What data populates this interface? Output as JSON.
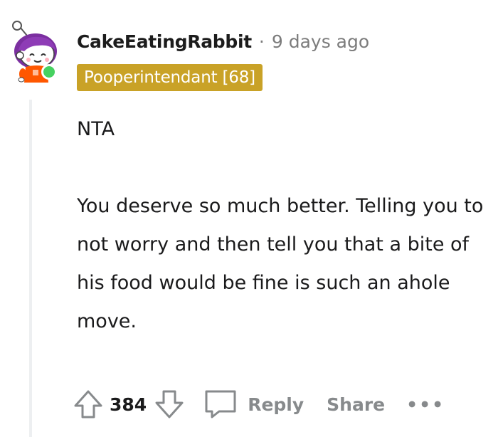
{
  "comment": {
    "username": "CakeEatingRabbit",
    "separator": "·",
    "timestamp": "9 days ago",
    "flair": "Pooperintendant [68]",
    "online": true,
    "avatar_icon": "snoo-avatar-purple-hair-orange-shirt",
    "body": {
      "paragraph_1": "NTA",
      "paragraph_2": "You deserve so much better. Telling you to not worry and then tell you that a bite of his food would be fine is such an ahole move."
    },
    "actions": {
      "upvote_icon": "upvote-arrow-icon",
      "vote_count": "384",
      "downvote_icon": "downvote-arrow-icon",
      "reply_icon": "speech-bubble-icon",
      "reply_label": "Reply",
      "share_label": "Share",
      "more_label": "•••"
    }
  },
  "colors": {
    "flair_bg": "#c9a227",
    "online": "#46d160",
    "muted": "#878a8c",
    "text": "#1a1a1b"
  }
}
